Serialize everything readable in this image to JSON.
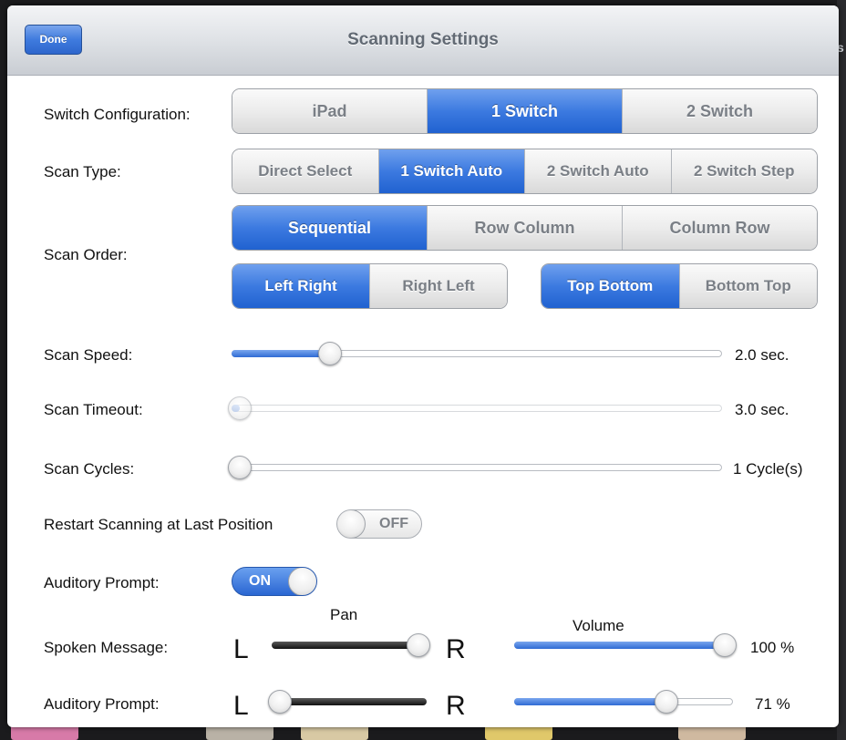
{
  "window": {
    "title": "Scanning Settings",
    "done_label": "Done"
  },
  "switch_configuration": {
    "label": "Switch Configuration:",
    "options": [
      "iPad",
      "1 Switch",
      "2 Switch"
    ],
    "selected": "1 Switch"
  },
  "scan_type": {
    "label": "Scan Type:",
    "options": [
      "Direct Select",
      "1 Switch Auto",
      "2 Switch Auto",
      "2 Switch Step"
    ],
    "selected": "1 Switch Auto"
  },
  "scan_order": {
    "label": "Scan Order:",
    "mode_options": [
      "Sequential",
      "Row Column",
      "Column Row"
    ],
    "mode_selected": "Sequential",
    "horizontal_options": [
      "Left Right",
      "Right Left"
    ],
    "horizontal_selected": "Left Right",
    "vertical_options": [
      "Top Bottom",
      "Bottom Top"
    ],
    "vertical_selected": "Top Bottom"
  },
  "scan_speed": {
    "label": "Scan Speed:",
    "value_text": "2.0 sec.",
    "fraction": 0.19
  },
  "scan_timeout": {
    "label": "Scan Timeout:",
    "value_text": "3.0 sec.",
    "fraction": 0.0
  },
  "scan_cycles": {
    "label": "Scan Cycles:",
    "value_text": "1 Cycle(s)",
    "fraction": 0.0
  },
  "restart_scanning": {
    "label": "Restart Scanning at Last Position",
    "state_text": "OFF"
  },
  "auditory_prompt_toggle": {
    "label": "Auditory Prompt:",
    "state_text": "ON"
  },
  "audio": {
    "pan_header": "Pan",
    "volume_header": "Volume",
    "left_letter": "L",
    "right_letter": "R",
    "rows": [
      {
        "label": "Spoken Message:",
        "pan_fraction": 1.0,
        "volume_fraction": 1.0,
        "volume_text": "100 %"
      },
      {
        "label": "Auditory Prompt:",
        "pan_fraction": 0.0,
        "volume_fraction": 0.71,
        "volume_text": "71 %"
      }
    ]
  },
  "background": {
    "edge_letter": "s"
  },
  "colors": {
    "accent": "#2f6bd4",
    "title_text": "#626a74"
  }
}
